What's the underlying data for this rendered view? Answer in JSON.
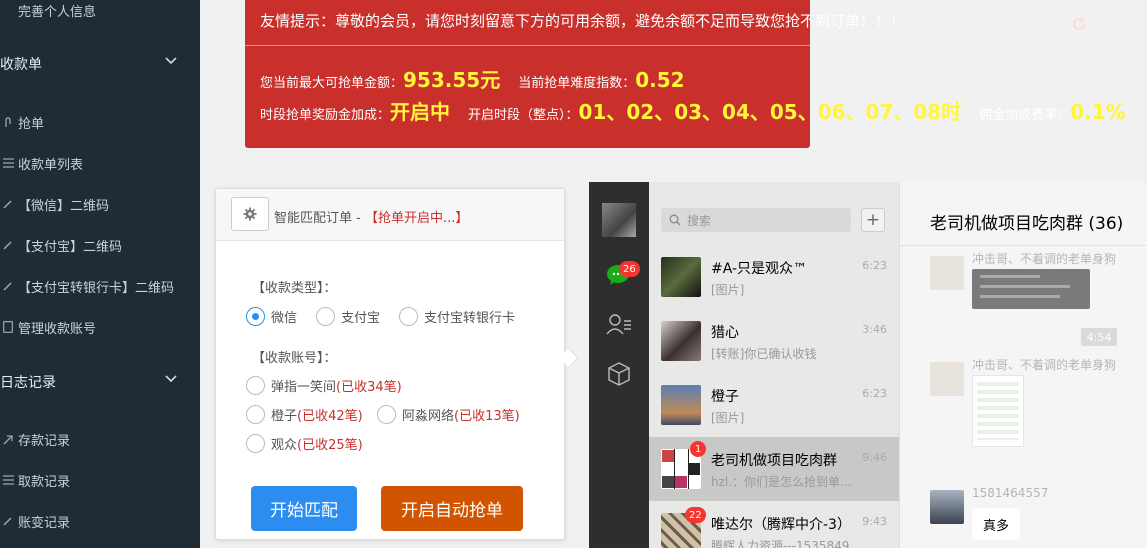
{
  "sidebar": {
    "profile": "完善个人信息",
    "section_orders": "收款单",
    "grab": "抢单",
    "order_list": "收款单列表",
    "wechat_qr": "【微信】二维码",
    "alipay_qr": "【支付宝】二维码",
    "alipay_bank_qr": "【支付宝转银行卡】二维码",
    "manage_accounts": "管理收款账号",
    "section_logs": "日志记录",
    "deposit_log": "存款记录",
    "withdraw_log": "取款记录",
    "balance_log": "账变记录"
  },
  "banner": {
    "warning": "友情提示：尊敬的会员，请您时刻留意下方的可用余额，避免余额不足而导致您抢不到订单！！！",
    "max_amount_label": "您当前最大可抢单金额：",
    "max_amount_value": "953.55元",
    "difficulty_label": "当前抢单难度指数：",
    "difficulty_value": "0.52",
    "bonus_label": "时段抢单奖励金加成：",
    "bonus_value": "开启中",
    "period_label": "开启时段（整点）：",
    "period_value": "01、02、03、04、05、06、07、08时",
    "commission_label": "佣金加成费率：",
    "commission_value": "0.1%",
    "accent": "#c9302c",
    "highlight": "#fff53b"
  },
  "panel": {
    "title": "智能匹配订单 - ",
    "status": "【抢单开启中...】",
    "type_label": "【收款类型】：",
    "type_options": [
      "微信",
      "支付宝",
      "支付宝转银行卡"
    ],
    "type_selected": "微信",
    "account_label": "【收款账号】：",
    "accounts": [
      {
        "name": "弹指一笑间",
        "count": "(已收34笔)"
      },
      {
        "name": "橙子",
        "count": "(已收42笔)"
      },
      {
        "name": "阿淼网络",
        "count": "(已收13笔)"
      },
      {
        "name": "观众",
        "count": "(已收25笔)"
      }
    ],
    "start_match": "开始匹配",
    "auto_grab": "开启自动抢单",
    "start_color": "#2d8cf0",
    "auto_color": "#d35400"
  },
  "chat": {
    "search_placeholder": "搜索",
    "plus": "+",
    "unread_badge": "26",
    "conversations": [
      {
        "name": "#A-只是观众™",
        "time": "6:23",
        "preview": "[图片]",
        "badge": ""
      },
      {
        "name": "猎心",
        "time": "3:46",
        "preview": "[转账]你已确认收钱",
        "badge": ""
      },
      {
        "name": "橙子",
        "time": "6:23",
        "preview": "[图片]",
        "badge": ""
      },
      {
        "name": "老司机做项目吃肉群",
        "time": "9:46",
        "preview": "hzl.：你们是怎么抢到单...",
        "badge": "1"
      },
      {
        "name": "唯达尔（腾辉中介-3）",
        "time": "9:43",
        "preview": "腾辉人力资源---1535849",
        "badge": "22"
      }
    ],
    "window_title": "老司机做项目吃肉群 (36)",
    "sender1": "冲击哥、不着调的老单身狗",
    "time_chip": "4:54",
    "sender2": "冲击哥、不着调的老单身狗",
    "sender3": "1581464557",
    "message": "真多"
  }
}
